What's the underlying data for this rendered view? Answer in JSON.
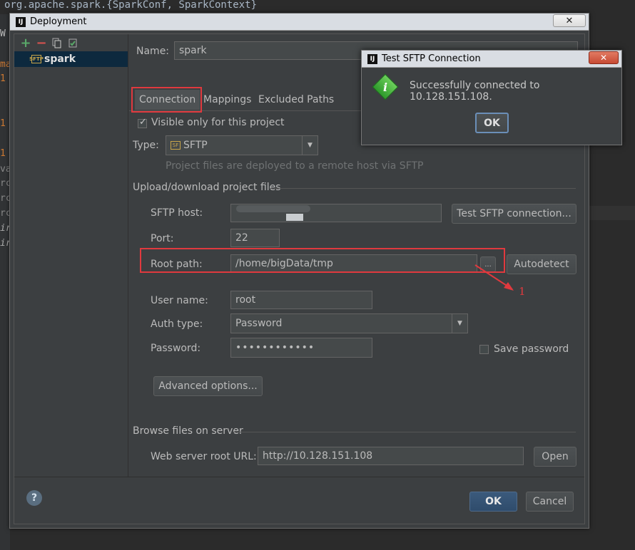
{
  "editor": {
    "top_line": "org.apache.spark.{SparkConf, SparkContext}",
    "gutter_fragments": [
      "W",
      "ma",
      "1",
      "1",
      "1",
      "va",
      "rc",
      "rc",
      "rc",
      "ir",
      "ir"
    ]
  },
  "dialog": {
    "title": "Deployment",
    "close_label": "✕",
    "toolbar": {
      "add": "+",
      "remove": "−",
      "copy": "copy-icon",
      "default": "default-icon"
    },
    "tree": {
      "item_label": "spark",
      "item_icon_text": "SFTP"
    },
    "name_label": "Name:",
    "name_value": "spark",
    "tabs": [
      {
        "label": "Connection",
        "active": true
      },
      {
        "label": "Mappings",
        "active": false
      },
      {
        "label": "Excluded Paths",
        "active": false
      }
    ],
    "visible_only": {
      "label": "Visible only for this project",
      "checked": true
    },
    "type_label": "Type:",
    "type_value": "SFTP",
    "type_hint": "Project files are deployed to a remote host via SFTP",
    "upload_section": "Upload/download project files",
    "sftp_host_label": "SFTP host:",
    "sftp_host_value": "",
    "test_button": "Test SFTP connection...",
    "port_label": "Port:",
    "port_value": "22",
    "root_path_label": "Root path:",
    "root_path_value": "/home/bigData/tmp",
    "browse_label": "...",
    "autodetect_button": "Autodetect",
    "annotation": "1",
    "user_name_label": "User name:",
    "user_name_value": "root",
    "auth_type_label": "Auth type:",
    "auth_type_value": "Password",
    "password_label": "Password:",
    "password_value": "••••••••••••",
    "save_password_label": "Save password",
    "save_password_checked": false,
    "advanced_button": "Advanced options...",
    "browse_section": "Browse files on server",
    "web_root_label": "Web server root URL:",
    "web_root_value": "http://10.128.151.108",
    "open_button": "Open",
    "help_label": "?",
    "ok_button": "OK",
    "cancel_button": "Cancel"
  },
  "popup": {
    "title": "Test SFTP Connection",
    "close_label": "✕",
    "message": "Successfully connected to 10.128.151.108.",
    "ok_button": "OK"
  },
  "colors": {
    "accent_red": "#e0393e",
    "background": "#3c3f41",
    "selection": "#0d293e"
  }
}
